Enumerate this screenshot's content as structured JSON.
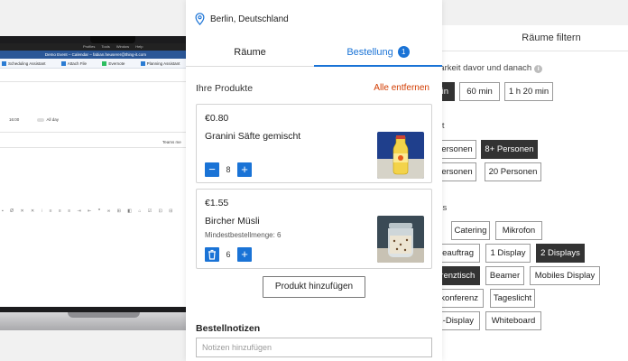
{
  "laptop": {
    "menubar": [
      "Profiles",
      "Tools",
      "Window",
      "Help"
    ],
    "window_title": "Demo Event – Calendar – fabian.heuserer@thing-it.com",
    "ribbon": [
      "Scheduling Assistant",
      "Attach File",
      "Evernote",
      "Planning Assistant"
    ],
    "time_value": "16:00",
    "allday_label": "All day",
    "teams_label": "Teams me"
  },
  "order_panel": {
    "location": "Berlin, Deutschland",
    "tabs": [
      {
        "label": "Räume"
      },
      {
        "label": "Bestellung",
        "badge": "1"
      }
    ],
    "section_title": "Ihre Produkte",
    "remove_all": "Alle entfernen",
    "products": [
      {
        "price": "€0.80",
        "name": "Granini Säfte gemischt",
        "note": "",
        "quantity": "8",
        "minus_icon": "minus-icon"
      },
      {
        "price": "€1.55",
        "name": "Bircher Müsli",
        "note": "Mindestbestellmenge: 6",
        "quantity": "6",
        "minus_icon": "trash-icon"
      }
    ],
    "add_product": "Produkt hinzufügen",
    "notes_label": "Bestellnotizen",
    "notes_placeholder": "Notizen hinzufügen"
  },
  "filter_panel": {
    "title": "Räume filtern",
    "availability_label": "barkeit davor und danach",
    "availability_options": [
      "in",
      "60 min",
      "1 h 20 min"
    ],
    "capacity_label": "tät",
    "capacity_options": [
      "Personen",
      "8+ Personen",
      "Personen",
      "20 Personen"
    ],
    "equipment_label": "rds",
    "equipment_options": [
      "Catering",
      "Mikrofon",
      "ceauftrag",
      "1 Display",
      "2 Displays",
      "erenztisch",
      "Beamer",
      "Mobiles Display",
      "okonferenz",
      "Tageslicht",
      "h-Display",
      "Whiteboard"
    ]
  },
  "colors": {
    "accent": "#1a73d6",
    "danger": "#d23c00",
    "chip_selected": "#333333"
  }
}
